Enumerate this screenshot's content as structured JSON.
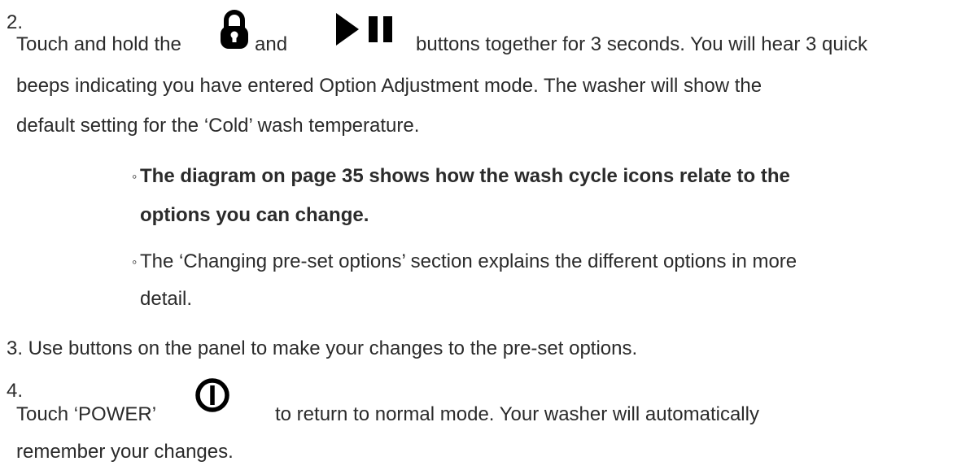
{
  "step2": {
    "number": "2.",
    "line1_a": "Touch and hold the",
    "line1_b": "and",
    "line1_c": "buttons together for 3 seconds. You will hear 3 quick",
    "line2": "beeps indicating you have entered Option Adjustment mode. The washer will show the",
    "line3": "default setting for the ‘Cold’ wash temperature.",
    "icons": [
      "lock-icon",
      "play-pause-icon"
    ],
    "bullets": [
      {
        "marker": "◦",
        "line1": "The diagram on page 35 shows how the wash cycle icons relate to the",
        "line2": "options you can change."
      },
      {
        "marker": "◦",
        "line1": "The ‘Changing pre-set options’ section explains the different options in more",
        "line2": "detail."
      }
    ]
  },
  "step3": {
    "text": "3. Use buttons on the panel to make your changes to the pre-set options."
  },
  "step4": {
    "number": "4.",
    "line1_a": "Touch ‘POWER’",
    "line1_b": "to return to normal mode. Your washer will automatically",
    "line2": "remember your changes.",
    "icons": [
      "power-icon"
    ]
  }
}
